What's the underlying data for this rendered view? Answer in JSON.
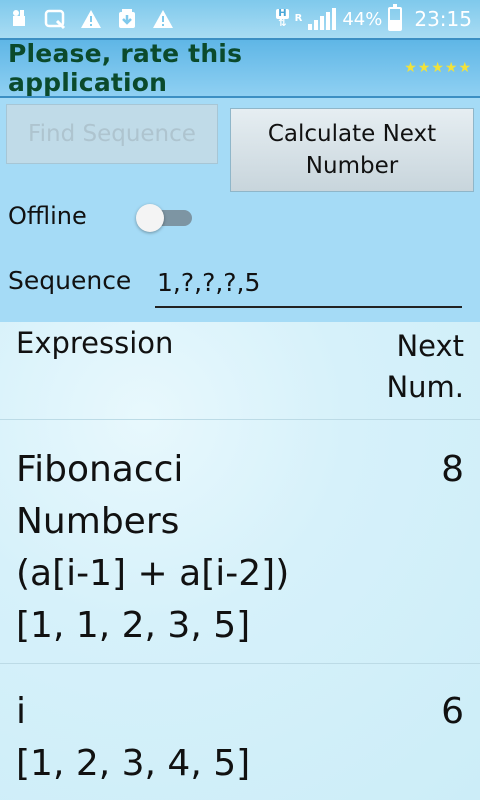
{
  "status_bar": {
    "icons": [
      "usb-icon",
      "screen-capture-icon",
      "warning-icon",
      "download-icon",
      "warning-icon"
    ],
    "network_badge": "H",
    "roaming_badge": "R",
    "battery_percent": "44%",
    "battery_level": 0.44,
    "time": "23:15"
  },
  "banner": {
    "text": "Please, rate this application",
    "stars": "★★★★★"
  },
  "buttons": {
    "find": "Find Sequence",
    "calculate_line1": "Calculate Next",
    "calculate_line2": "Number"
  },
  "offline": {
    "label": "Offline",
    "enabled": false
  },
  "sequence": {
    "label": "Sequence",
    "value": "1,?,?,?,5"
  },
  "table": {
    "header_expression": "Expression",
    "header_next_line1": "Next",
    "header_next_line2": "Num.",
    "rows": [
      {
        "lines": [
          "Fibonacci",
          "Numbers",
          "(a[i-1] + a[i-2])",
          "[1, 1, 2, 3, 5]"
        ],
        "next": "8"
      },
      {
        "lines": [
          "i",
          "[1, 2, 3, 4, 5]"
        ],
        "next": "6"
      }
    ]
  }
}
